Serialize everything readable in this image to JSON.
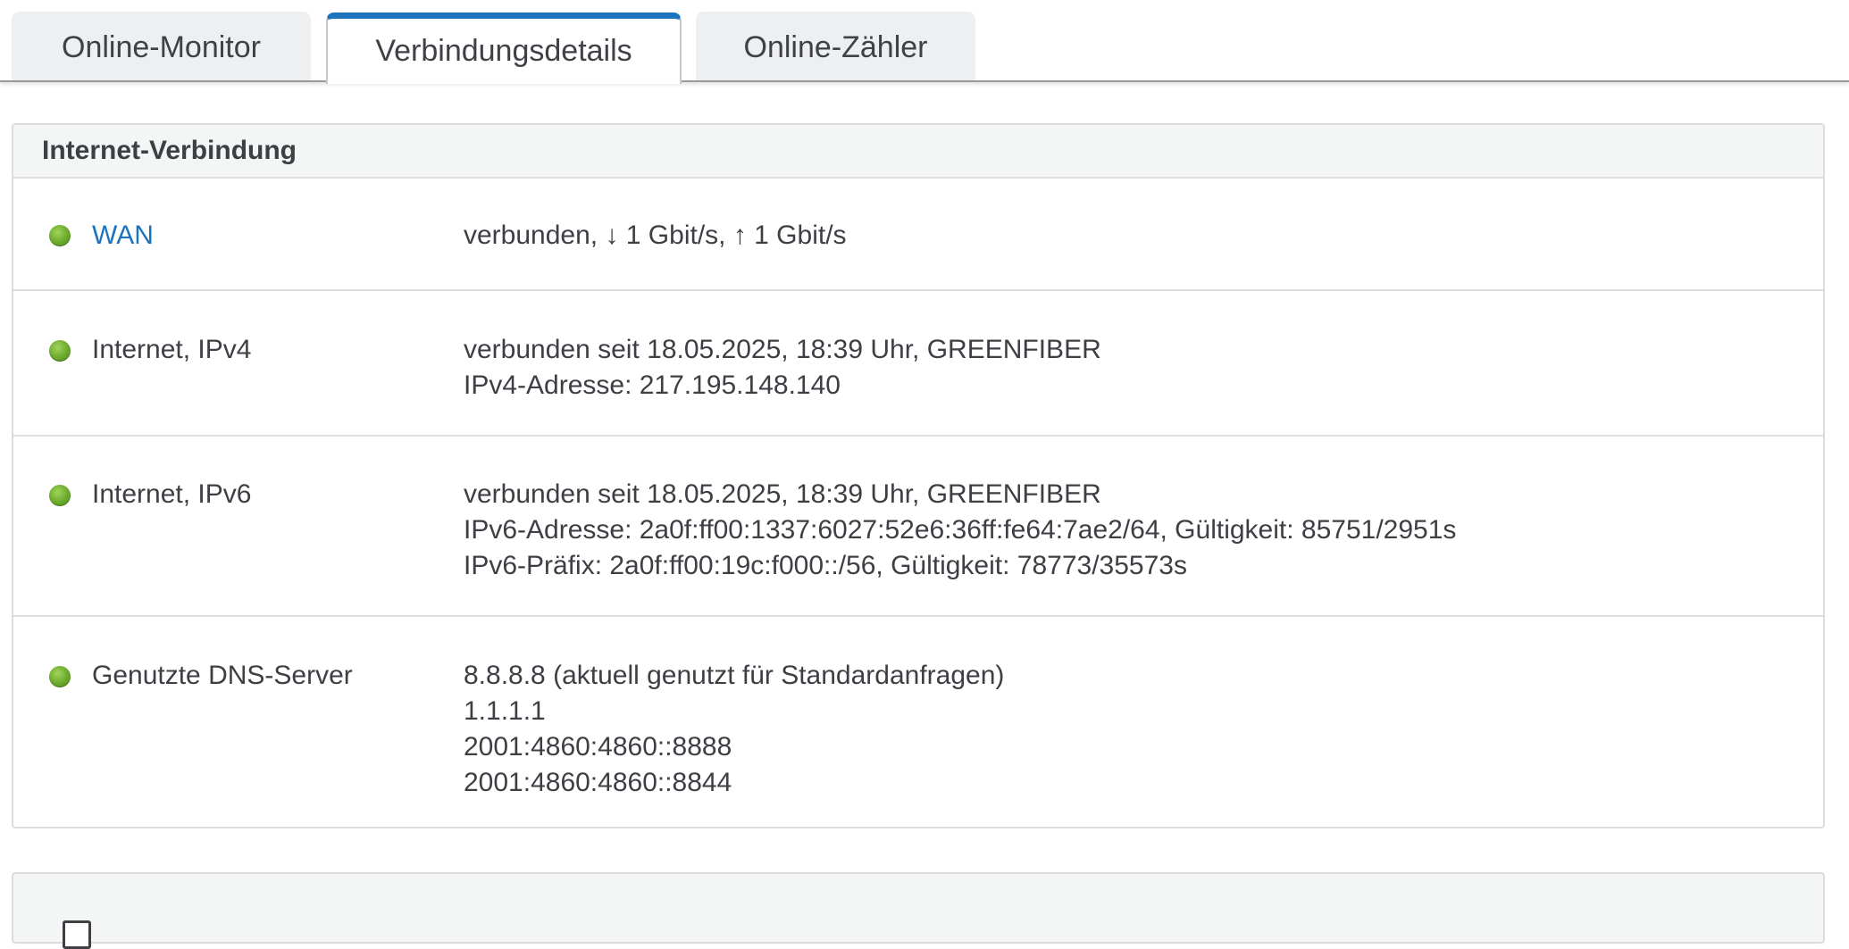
{
  "tabs": [
    {
      "label": "Online-Monitor",
      "active": false
    },
    {
      "label": "Verbindungsdetails",
      "active": true
    },
    {
      "label": "Online-Zähler",
      "active": false
    }
  ],
  "accent_color": "#1e73be",
  "status_color": "#6aa82c",
  "panel": {
    "title": "Internet-Verbindung",
    "rows": [
      {
        "label": "WAN",
        "status": "connected",
        "lines": [
          "verbunden, ↓ 1 Gbit/s, ↑ 1 Gbit/s"
        ]
      },
      {
        "label": "Internet, IPv4",
        "status": "connected",
        "lines": [
          "verbunden seit 18.05.2025, 18:39 Uhr, GREENFIBER",
          "IPv4-Adresse: 217.195.148.140"
        ]
      },
      {
        "label": "Internet, IPv6",
        "status": "connected",
        "lines": [
          "verbunden seit 18.05.2025, 18:39 Uhr, GREENFIBER",
          "IPv6-Adresse: 2a0f:ff00:1337:6027:52e6:36ff:fe64:7ae2/64, Gültigkeit: 85751/2951s",
          "IPv6-Präfix: 2a0f:ff00:19c:f000::/56, Gültigkeit: 78773/35573s"
        ]
      },
      {
        "label": "Genutzte DNS-Server",
        "status": "connected",
        "lines": [
          "8.8.8.8 (aktuell genutzt für Standardanfragen)",
          "1.1.1.1",
          "2001:4860:4860::8888",
          "2001:4860:4860::8844"
        ]
      }
    ]
  }
}
